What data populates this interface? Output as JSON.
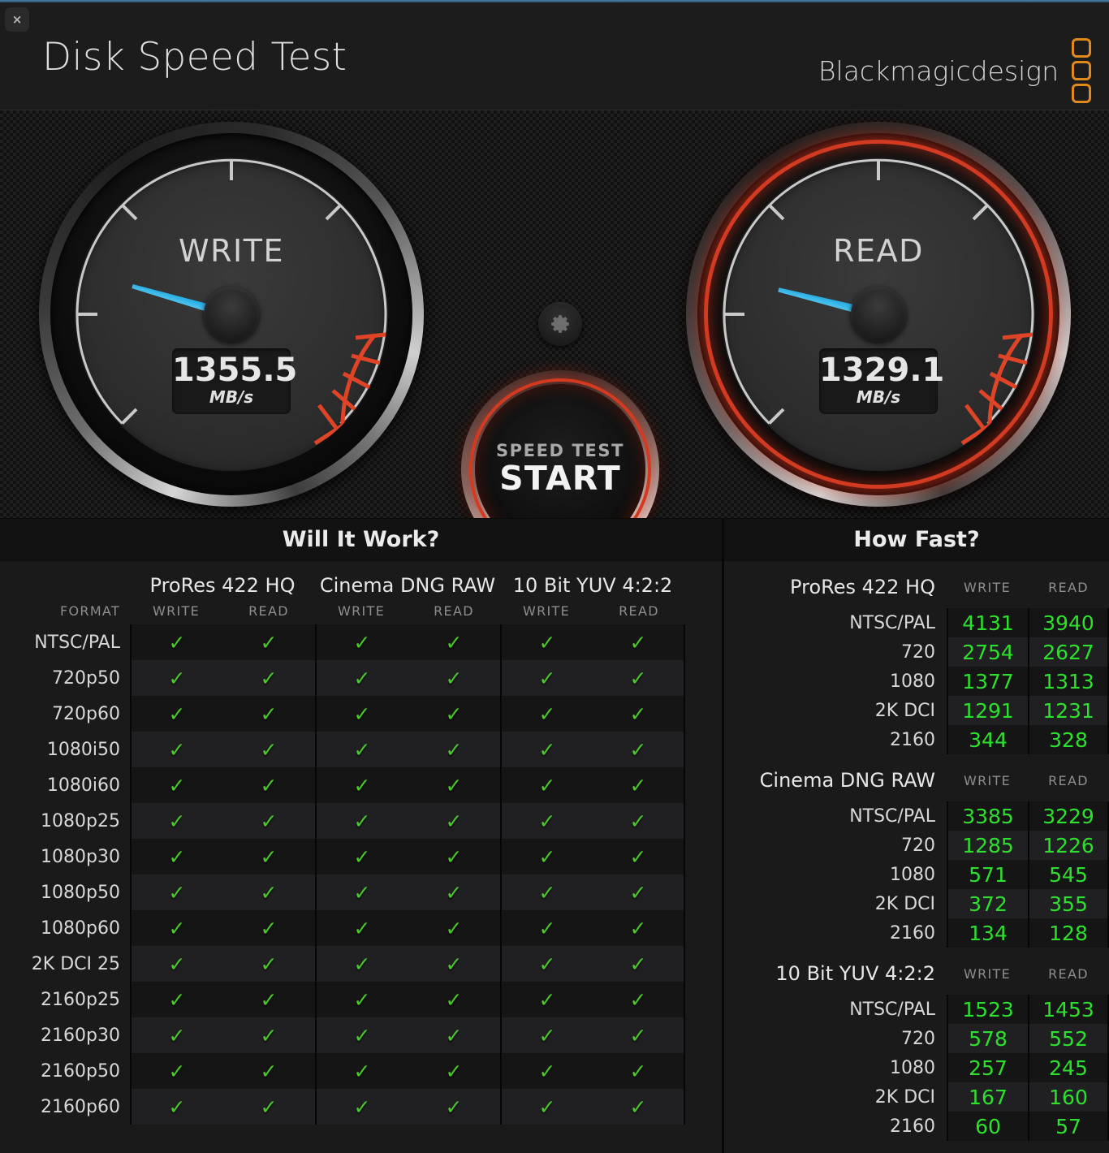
{
  "window": {
    "close_label": "×"
  },
  "header": {
    "title": "Disk Speed Test",
    "brand": "Blackmagicdesign",
    "logo_icon": "blackmagic-logo-icon"
  },
  "gauges": {
    "write": {
      "label": "WRITE",
      "value": "1355.5",
      "unit": "MB/s",
      "angle": -164,
      "active": false
    },
    "read": {
      "label": "READ",
      "value": "1329.1",
      "unit": "MB/s",
      "angle": -166,
      "active": true
    }
  },
  "controls": {
    "settings_icon": "gear-icon",
    "start_line1": "SPEED TEST",
    "start_line2": "START"
  },
  "will_it_work": {
    "title": "Will It Work?",
    "format_header": "FORMAT",
    "groups": [
      "ProRes 422 HQ",
      "Cinema DNG RAW",
      "10 Bit YUV 4:2:2"
    ],
    "sub_headers": [
      "WRITE",
      "READ"
    ],
    "check_glyph": "✓",
    "rows": [
      {
        "format": "NTSC/PAL",
        "cells": [
          true,
          true,
          true,
          true,
          true,
          true
        ]
      },
      {
        "format": "720p50",
        "cells": [
          true,
          true,
          true,
          true,
          true,
          true
        ]
      },
      {
        "format": "720p60",
        "cells": [
          true,
          true,
          true,
          true,
          true,
          true
        ]
      },
      {
        "format": "1080i50",
        "cells": [
          true,
          true,
          true,
          true,
          true,
          true
        ]
      },
      {
        "format": "1080i60",
        "cells": [
          true,
          true,
          true,
          true,
          true,
          true
        ]
      },
      {
        "format": "1080p25",
        "cells": [
          true,
          true,
          true,
          true,
          true,
          true
        ]
      },
      {
        "format": "1080p30",
        "cells": [
          true,
          true,
          true,
          true,
          true,
          true
        ]
      },
      {
        "format": "1080p50",
        "cells": [
          true,
          true,
          true,
          true,
          true,
          true
        ]
      },
      {
        "format": "1080p60",
        "cells": [
          true,
          true,
          true,
          true,
          true,
          true
        ]
      },
      {
        "format": "2K DCI 25",
        "cells": [
          true,
          true,
          true,
          true,
          true,
          true
        ]
      },
      {
        "format": "2160p25",
        "cells": [
          true,
          true,
          true,
          true,
          true,
          true
        ]
      },
      {
        "format": "2160p30",
        "cells": [
          true,
          true,
          true,
          true,
          true,
          true
        ]
      },
      {
        "format": "2160p50",
        "cells": [
          true,
          true,
          true,
          true,
          true,
          true
        ]
      },
      {
        "format": "2160p60",
        "cells": [
          true,
          true,
          true,
          true,
          true,
          true
        ]
      }
    ]
  },
  "how_fast": {
    "title": "How Fast?",
    "write_header": "WRITE",
    "read_header": "READ",
    "sections": [
      {
        "name": "ProRes 422 HQ",
        "rows": [
          {
            "label": "NTSC/PAL",
            "write": "4131",
            "read": "3940"
          },
          {
            "label": "720",
            "write": "2754",
            "read": "2627"
          },
          {
            "label": "1080",
            "write": "1377",
            "read": "1313"
          },
          {
            "label": "2K DCI",
            "write": "1291",
            "read": "1231"
          },
          {
            "label": "2160",
            "write": "344",
            "read": "328"
          }
        ]
      },
      {
        "name": "Cinema DNG RAW",
        "rows": [
          {
            "label": "NTSC/PAL",
            "write": "3385",
            "read": "3229"
          },
          {
            "label": "720",
            "write": "1285",
            "read": "1226"
          },
          {
            "label": "1080",
            "write": "571",
            "read": "545"
          },
          {
            "label": "2K DCI",
            "write": "372",
            "read": "355"
          },
          {
            "label": "2160",
            "write": "134",
            "read": "128"
          }
        ]
      },
      {
        "name": "10 Bit YUV 4:2:2",
        "rows": [
          {
            "label": "NTSC/PAL",
            "write": "1523",
            "read": "1453"
          },
          {
            "label": "720",
            "write": "578",
            "read": "552"
          },
          {
            "label": "1080",
            "write": "257",
            "read": "245"
          },
          {
            "label": "2K DCI",
            "write": "167",
            "read": "160"
          },
          {
            "label": "2160",
            "write": "60",
            "read": "57"
          }
        ]
      }
    ]
  },
  "colors": {
    "accent_red": "#d43a20",
    "needle_blue": "#2ab4e8",
    "check_green": "#4ac82a",
    "value_green": "#2ee02e",
    "brand_orange": "#e08a1e"
  }
}
